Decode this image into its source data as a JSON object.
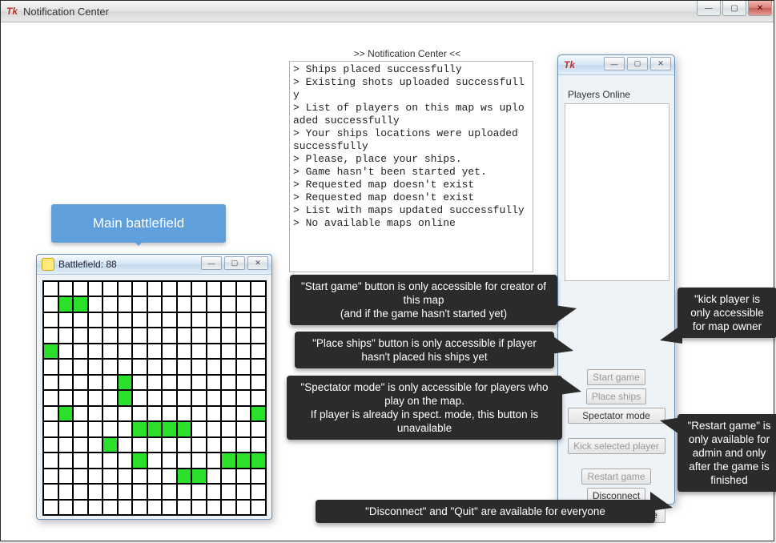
{
  "outer_window": {
    "title": "Notification Center"
  },
  "notification_header": ">> Notification Center <<",
  "log_text": "> Ships placed successfully\n> Existing shots uploaded successfully\n> List of players on this map ws uploaded successfully\n> Your ships locations were uploaded successfully\n> Please, place your ships.\n> Game hasn't been started yet.\n> Requested map doesn't exist\n> Requested map doesn't exist\n> List with maps updated successfully\n> No available maps online",
  "main_battlefield_label": "Main battlefield",
  "battlefield": {
    "title": "Battlefield: 88",
    "grid_size": 15,
    "ship_cells": [
      [
        1,
        1
      ],
      [
        1,
        2
      ],
      [
        4,
        0
      ],
      [
        6,
        5
      ],
      [
        7,
        5
      ],
      [
        8,
        1
      ],
      [
        8,
        14
      ],
      [
        9,
        6
      ],
      [
        9,
        7
      ],
      [
        9,
        8
      ],
      [
        9,
        9
      ],
      [
        10,
        4
      ],
      [
        11,
        6
      ],
      [
        11,
        12
      ],
      [
        11,
        13
      ],
      [
        11,
        14
      ],
      [
        12,
        9
      ],
      [
        12,
        10
      ]
    ]
  },
  "players_panel": {
    "title_label": "Players Online",
    "buttons": {
      "start_game": {
        "label": "Start game",
        "enabled": false
      },
      "place_ships": {
        "label": "Place ships",
        "enabled": false
      },
      "spectator": {
        "label": "Spectator mode",
        "enabled": true
      },
      "kick": {
        "label": "Kick selected player",
        "enabled": false
      },
      "restart": {
        "label": "Restart game",
        "enabled": false
      },
      "disconnect": {
        "label": "Disconnect",
        "enabled": true
      },
      "quit": {
        "label": "Quit from the game",
        "enabled": true
      }
    }
  },
  "callouts": {
    "start": "\"Start game\" button is only accessible for creator of this map\n(and if the game hasn't started yet)",
    "place": "\"Place ships\" button is only accessible if player hasn't placed his ships yet",
    "spectator": "\"Spectator mode\" is only accessible for players who play on the map.\nIf player is already in spect. mode, this button is unavailable",
    "kick": "\"kick player is only accessible for map owner",
    "restart": "\"Restart game\" is only available for admin and only after the game is finished",
    "discquit": "\"Disconnect\" and \"Quit\" are available for everyone"
  }
}
